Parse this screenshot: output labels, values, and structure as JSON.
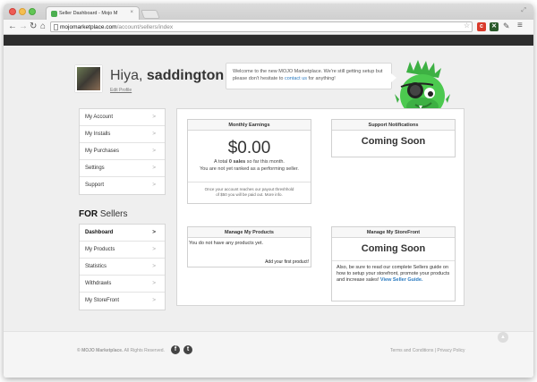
{
  "browser": {
    "tab_title": "Seller Dashboard - Mojo M",
    "url_host": "mojomarketplace.com",
    "url_path": "/account/sellers/index"
  },
  "header": {
    "greeting_prefix": "Hiya,",
    "username": "saddington",
    "edit_profile": "Edit Profile",
    "welcome_text": "Welcome to the new MOJO Marketplace. We're still getting setup but please don't hesitate to",
    "contact_link": "contact us",
    "welcome_suffix": "for anything!"
  },
  "account_menu": [
    {
      "label": "My Account"
    },
    {
      "label": "My Installs"
    },
    {
      "label": "My Purchases"
    },
    {
      "label": "Settings"
    },
    {
      "label": "Support"
    }
  ],
  "sellers": {
    "heading_bold": "FOR",
    "heading_rest": "Sellers",
    "items": [
      {
        "label": "Dashboard",
        "active": true
      },
      {
        "label": "My Products"
      },
      {
        "label": "Statistics"
      },
      {
        "label": "Withdrawls"
      },
      {
        "label": "My StoreFront"
      }
    ]
  },
  "earnings": {
    "title": "Monthly Earnings",
    "amount": "$0.00",
    "line1_prefix": "A total",
    "line1_bold": "0 sales",
    "line1_suffix": "so far this month.",
    "line2": "You are not yet ranked as a performing seller.",
    "foot1": "Once your account reaches our payout threshhold",
    "foot2": "of $50 you will be paid out. More info."
  },
  "support": {
    "title": "Support Notifications",
    "status": "Coming Soon"
  },
  "products": {
    "title": "Manage My Products",
    "empty": "You do not have any products yet.",
    "add_link": "Add your first product!"
  },
  "storefront": {
    "title": "Manage My StoreFront",
    "status": "Coming Soon",
    "text": "Also, be sure to read our complete Sellers guide on how to setup your storefront, promote your products and increase sales!",
    "guide_link": "View Seller Guide."
  },
  "footer": {
    "copyright_bold": "© MOJO Marketplace.",
    "copyright_rest": "All Rights Reserved.",
    "links": "Terms and Conditions | Privacy Policy"
  },
  "colors": {
    "accent_link": "#2a7ac0",
    "header_bar": "#2d2d2d"
  }
}
